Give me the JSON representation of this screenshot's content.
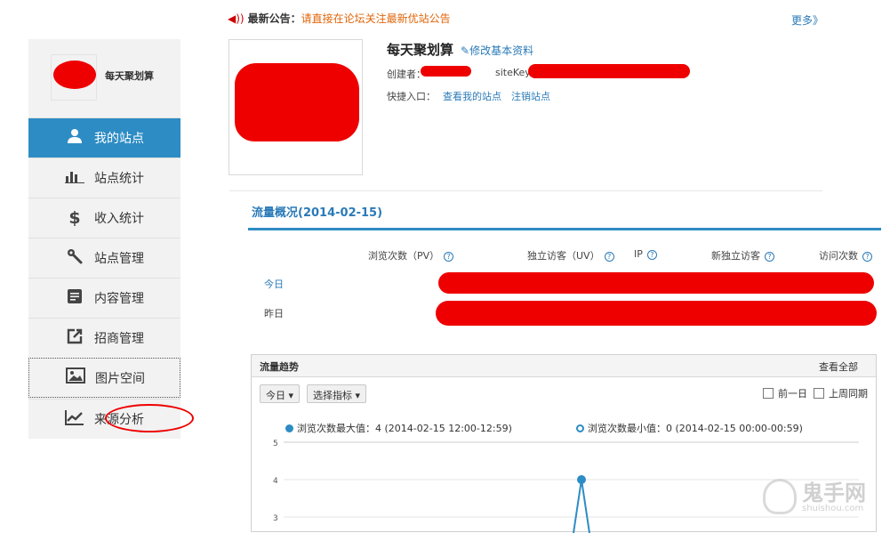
{
  "announcement": {
    "icon": "speaker-icon",
    "label": "最新公告：",
    "text": "请直接在论坛关注最新优站公告",
    "more": "更多》"
  },
  "sidebar": {
    "site_name": "每天聚划算",
    "items": [
      {
        "label": "我的站点",
        "icon": "user-icon",
        "active": true
      },
      {
        "label": "站点统计",
        "icon": "bar-chart-icon"
      },
      {
        "label": "收入统计",
        "icon": "dollar-icon"
      },
      {
        "label": "站点管理",
        "icon": "wrench-icon"
      },
      {
        "label": "内容管理",
        "icon": "document-icon"
      },
      {
        "label": "招商管理",
        "icon": "external-link-icon"
      },
      {
        "label": "图片空间",
        "icon": "image-icon"
      },
      {
        "label": "来源分析",
        "icon": "trend-chart-icon"
      }
    ]
  },
  "site": {
    "title": "每天聚划算",
    "edit_link": "修改基本资料",
    "creator_label": "创建者：",
    "sitekey_label": "siteKey:",
    "quick_label": "快捷入口：",
    "quick_links": [
      "查看我的站点",
      "注销站点"
    ]
  },
  "traffic": {
    "title": "流量概况(2014-02-15)",
    "columns": [
      "浏览次数（PV）",
      "独立访客（UV）",
      "IP",
      "新独立访客",
      "访问次数"
    ],
    "rows": [
      "今日",
      "昨日"
    ]
  },
  "trend": {
    "title": "流量趋势",
    "view_all": "查看全部",
    "range_button": "今日",
    "metric_button": "选择指标",
    "checkboxes": [
      "前一日",
      "上周同期"
    ],
    "legend_max": "浏览次数最大值：4 (2014-02-15 12:00-12:59)",
    "legend_min": "浏览次数最小值：0 (2014-02-15 00:00-00:59)"
  },
  "chart_data": {
    "type": "line",
    "y_ticks": [
      "5",
      "4",
      "3"
    ],
    "ylim": [
      0,
      5
    ],
    "series": [
      {
        "peak_value": 4,
        "peak_time": "2014-02-15 12:00-12:59"
      }
    ],
    "colors": {
      "series": "#2d8cc4"
    }
  },
  "watermark": {
    "title": "鬼手网",
    "url": "shuishou.com"
  }
}
